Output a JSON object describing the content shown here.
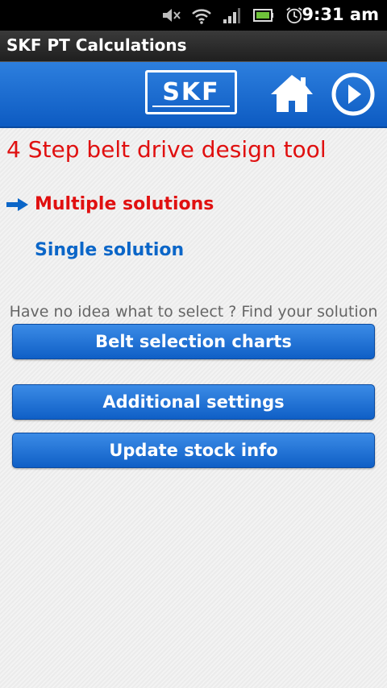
{
  "status_bar": {
    "time": "9:31 am",
    "icons": [
      "mute-icon",
      "wifi-icon",
      "signal-icon",
      "battery-icon",
      "alarm-icon"
    ]
  },
  "app": {
    "title": "SKF PT Calculations"
  },
  "header": {
    "logo_text": "SKF",
    "home_icon": "home-icon",
    "next_icon": "play-circle-icon"
  },
  "main": {
    "title": "4 Step belt drive design tool",
    "options": [
      {
        "label": "Multiple solutions",
        "selected": true,
        "color": "#e01010"
      },
      {
        "label": "Single solution",
        "selected": false,
        "color": "#0b66c8"
      }
    ],
    "hint": "Have no idea what to select ? Find your solution",
    "buttons": [
      {
        "label": "Belt selection charts"
      },
      {
        "label": "Additional settings"
      },
      {
        "label": "Update stock info"
      }
    ]
  },
  "colors": {
    "accent_blue": "#0d5bc2",
    "selected_red": "#e01010",
    "link_blue": "#0b66c8"
  }
}
